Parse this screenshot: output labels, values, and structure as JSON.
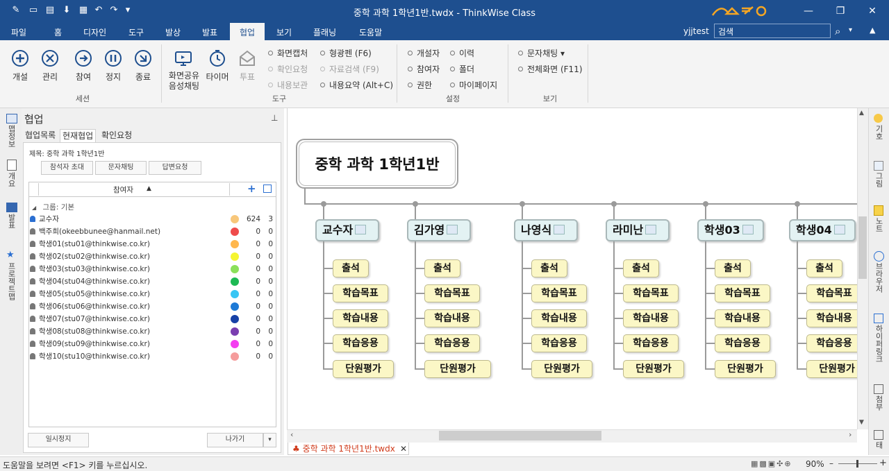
{
  "window": {
    "title": "중학 과학 1학년1반.twdx - ThinkWise Class",
    "min_glyph": "—",
    "restore_glyph": "❐",
    "close_glyph": "✕"
  },
  "menu": {
    "items": [
      "파일",
      "홈",
      "디자인",
      "도구",
      "발상",
      "발표",
      "협업",
      "보기",
      "플래닝",
      "도움말"
    ],
    "active": "협업",
    "user": "yjjtest",
    "search_placeholder": "검색"
  },
  "ribbon": {
    "session": {
      "label": "세션",
      "buttons": [
        "개설",
        "관리",
        "참여",
        "정지",
        "종료"
      ]
    },
    "tools": {
      "label": "도구",
      "buttons": [
        "화면공유\n음성채팅",
        "타이머",
        "투표"
      ],
      "list": [
        {
          "text": "화면캡처",
          "dim": false
        },
        {
          "text": "확인요청",
          "dim": true
        },
        {
          "text": "내용보관",
          "dim": true
        },
        {
          "text": "형광펜 (F6)",
          "dim": false
        },
        {
          "text": "자료검색 (F9)",
          "dim": true
        },
        {
          "text": "내용요약 (Alt+C)",
          "dim": false
        }
      ]
    },
    "settings": {
      "label": "설정",
      "list": [
        {
          "text": "개설자",
          "dim": false
        },
        {
          "text": "참여자",
          "dim": false
        },
        {
          "text": "권한",
          "dim": false
        },
        {
          "text": "이력",
          "dim": false
        },
        {
          "text": "폴더",
          "dim": false
        },
        {
          "text": "마이페이지",
          "dim": false
        }
      ]
    },
    "view": {
      "label": "보기",
      "list": [
        {
          "text": "문자채팅 ▾",
          "dim": false
        },
        {
          "text": "전체화면 (F11)",
          "dim": false
        }
      ]
    }
  },
  "leftbar": {
    "tabs": [
      "맵정보",
      "개요",
      "발표",
      "프로젝트맵"
    ]
  },
  "panel": {
    "title": "협업",
    "tabs": [
      "협업목록",
      "현재협업",
      "확인요청"
    ],
    "active_tab": "현재협업",
    "subject": "제목: 중학 과학 1학년1반",
    "buttons": [
      "참석자 초대",
      "문자채팅",
      "답변요청"
    ],
    "list_header": "참여자",
    "group": "그룹: 기본",
    "participants": [
      {
        "name": "교수자",
        "color": "#f8c77a",
        "n1": "624",
        "n2": "3",
        "owner": true
      },
      {
        "name": "백주희(okeebbunee@hanmail.net)",
        "color": "#ef4b4b",
        "n1": "0",
        "n2": "0"
      },
      {
        "name": "학생01(stu01@thinkwise.co.kr)",
        "color": "#ffb74d",
        "n1": "0",
        "n2": "0"
      },
      {
        "name": "학생02(stu02@thinkwise.co.kr)",
        "color": "#f5f531",
        "n1": "0",
        "n2": "0"
      },
      {
        "name": "학생03(stu03@thinkwise.co.kr)",
        "color": "#8be05a",
        "n1": "0",
        "n2": "0"
      },
      {
        "name": "학생04(stu04@thinkwise.co.kr)",
        "color": "#1db954",
        "n1": "0",
        "n2": "0"
      },
      {
        "name": "학생05(stu05@thinkwise.co.kr)",
        "color": "#38c6f4",
        "n1": "0",
        "n2": "0"
      },
      {
        "name": "학생06(stu06@thinkwise.co.kr)",
        "color": "#1e7ad6",
        "n1": "0",
        "n2": "0"
      },
      {
        "name": "학생07(stu07@thinkwise.co.kr)",
        "color": "#1741a6",
        "n1": "0",
        "n2": "0"
      },
      {
        "name": "학생08(stu08@thinkwise.co.kr)",
        "color": "#7a3eb0",
        "n1": "0",
        "n2": "0"
      },
      {
        "name": "학생09(stu09@thinkwise.co.kr)",
        "color": "#f43df0",
        "n1": "0",
        "n2": "0"
      },
      {
        "name": "학생10(stu10@thinkwise.co.kr)",
        "color": "#f59c9c",
        "n1": "0",
        "n2": "0"
      }
    ],
    "pause_button": "일시정지",
    "leave_button": "나가기"
  },
  "map": {
    "root": "중학 과학 1학년1반",
    "branches": [
      {
        "title": "교수자",
        "children": [
          "출석",
          "학습목표",
          "학습내용",
          "학습응용",
          "단원평가"
        ]
      },
      {
        "title": "김가영",
        "children": [
          "출석",
          "학습목표",
          "학습내용",
          "학습응용",
          "단원평가"
        ]
      },
      {
        "title": "나영식",
        "children": [
          "출석",
          "학습목표",
          "학습내용",
          "학습응용",
          "단원평가"
        ]
      },
      {
        "title": "라미난",
        "children": [
          "출석",
          "학습목표",
          "학습내용",
          "학습응용",
          "단원평가"
        ]
      },
      {
        "title": "학생03",
        "children": [
          "출석",
          "학습목표",
          "학습내용",
          "학습응용",
          "단원평가"
        ]
      },
      {
        "title": "학생04",
        "children": [
          "출석",
          "학습목표",
          "학습내용",
          "학습응용",
          "단원평가"
        ]
      }
    ]
  },
  "rightbar": {
    "tabs": [
      "기호",
      "그림",
      "노트",
      "브라우저",
      "하이퍼링크",
      "첨부",
      "태스"
    ]
  },
  "doc_tab": "중학 과학 1학년1반.twdx",
  "status": {
    "help": "도움말을 보려면 <F1> 키를 누르십시오.",
    "zoom": "90%"
  }
}
